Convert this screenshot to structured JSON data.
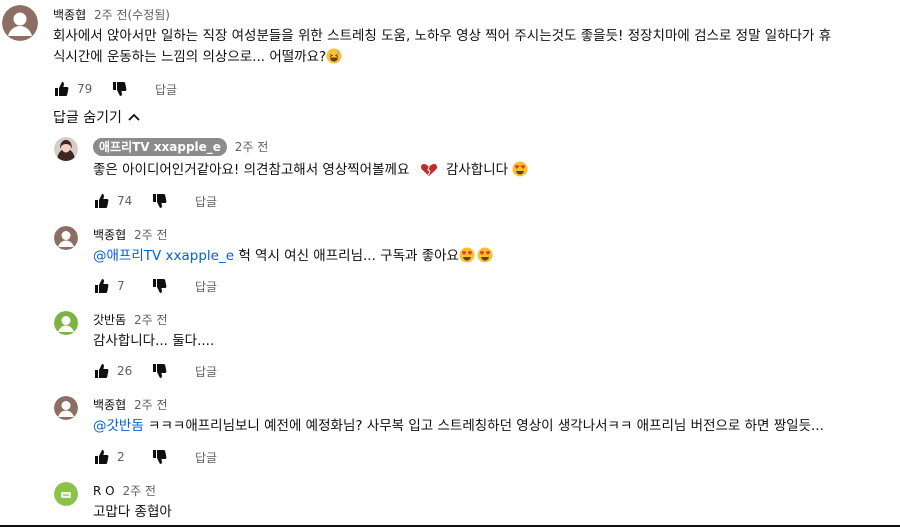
{
  "top_comment": {
    "author": "백종협",
    "time": "2주 전(수정됨)",
    "text_line1": "회사에서 앉아서만 일하는 직장 여성분들을 위한 스트레칭 도움, 노하우 영상 찍어 주시는것도 좋을듯! 정장치마에 검스로 정말 일하다가 휴",
    "text_line2": "식시간에 운동하는 느낌의 의상으로... 어떨까요?",
    "likes": "79",
    "reply_label": "답글"
  },
  "replies_toggle": {
    "label": "답글 숨기기"
  },
  "replies": [
    {
      "author": "애프리TV xxapple_e",
      "time": "2주 전",
      "text": "좋은 아이디어인거같아요! 의견참고해서 영상찍어볼께요",
      "text_after": "감사합니다",
      "likes": "74",
      "reply_label": "답글"
    },
    {
      "author": "백종협",
      "time": "2주 전",
      "mention": "@애프리TV xxapple_e",
      "text": " 헉 역시 여신 애프리님... 구독과 좋아요",
      "likes": "7",
      "reply_label": "답글"
    },
    {
      "author": "갓반돔",
      "time": "2주 전",
      "text": "감사합니다... 둘다....",
      "likes": "26",
      "reply_label": "답글"
    },
    {
      "author": "백종협",
      "time": "2주 전",
      "mention": "@갓반돔",
      "text": " ㅋㅋㅋ애프리님보니 예전에 예정화님? 사무복 입고 스트레칭하던 영상이 생각나서ㅋㅋ 애프리님 버전으로 하면 짱일듯...",
      "likes": "2",
      "reply_label": "답글"
    },
    {
      "author": "R O",
      "time": "2주 전",
      "text": "고맙다 종협아"
    }
  ],
  "colors": {
    "avatar_brown": "#8d6e63",
    "avatar_green": "#7cb342",
    "avatar_lime": "#8bc34a",
    "badge_gray": "#8c8c8c",
    "mention_blue": "#065fd4",
    "heart_red": "#c62828"
  }
}
